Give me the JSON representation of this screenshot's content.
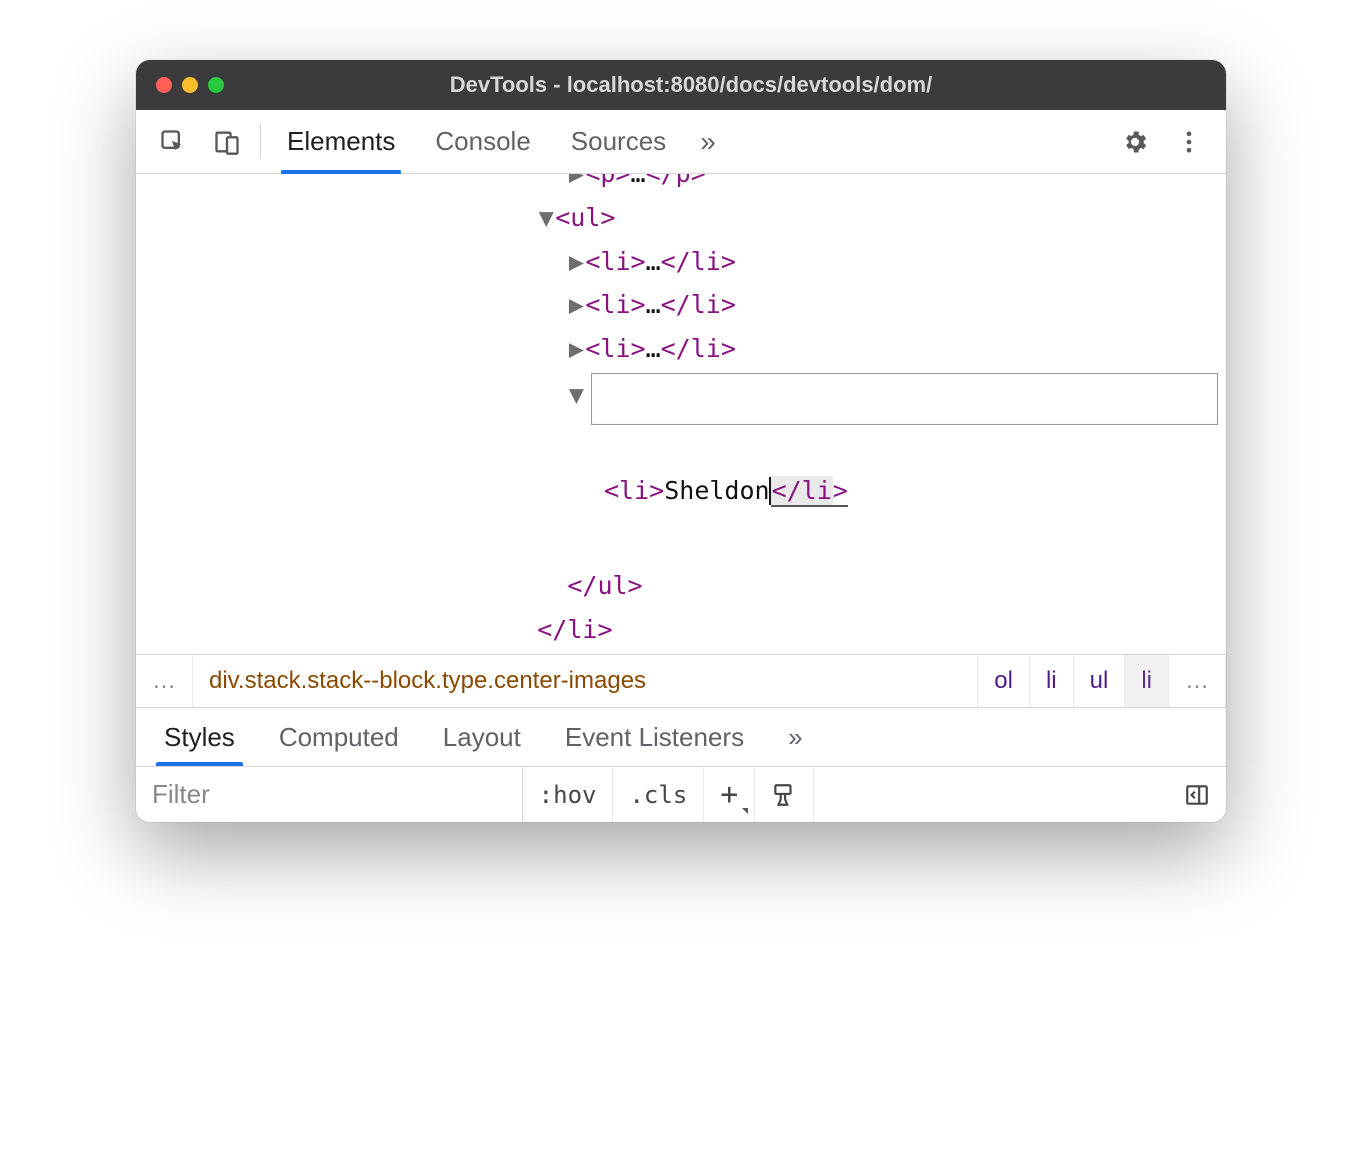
{
  "window": {
    "title": "DevTools - localhost:8080/docs/devtools/dom/"
  },
  "toolbar": {
    "tabs": [
      "Elements",
      "Console",
      "Sources"
    ],
    "active_tab": 0
  },
  "dom_tree": {
    "partial_top_open": "<p>",
    "partial_top_close": "</p>",
    "ul_open": "<ul>",
    "li_collapsed_open": "<li>",
    "li_collapsed_close": "</li>",
    "ellipsis": "…",
    "edit_open": "<li>",
    "edit_text": "Sheldon",
    "edit_close_inner": "</li",
    "edit_close_gt": ">",
    "ul_close": "</ul>",
    "li_close": "</li>"
  },
  "breadcrumbs": {
    "left_ellipsis": "…",
    "main": "div.stack.stack--block.type.center-images",
    "items": [
      "ol",
      "li",
      "ul",
      "li"
    ],
    "right_ellipsis": "…"
  },
  "styles_tabs": {
    "items": [
      "Styles",
      "Computed",
      "Layout",
      "Event Listeners"
    ],
    "active": 0
  },
  "filter": {
    "placeholder": "Filter",
    "hov": ":hov",
    "cls": ".cls",
    "plus": "+"
  }
}
